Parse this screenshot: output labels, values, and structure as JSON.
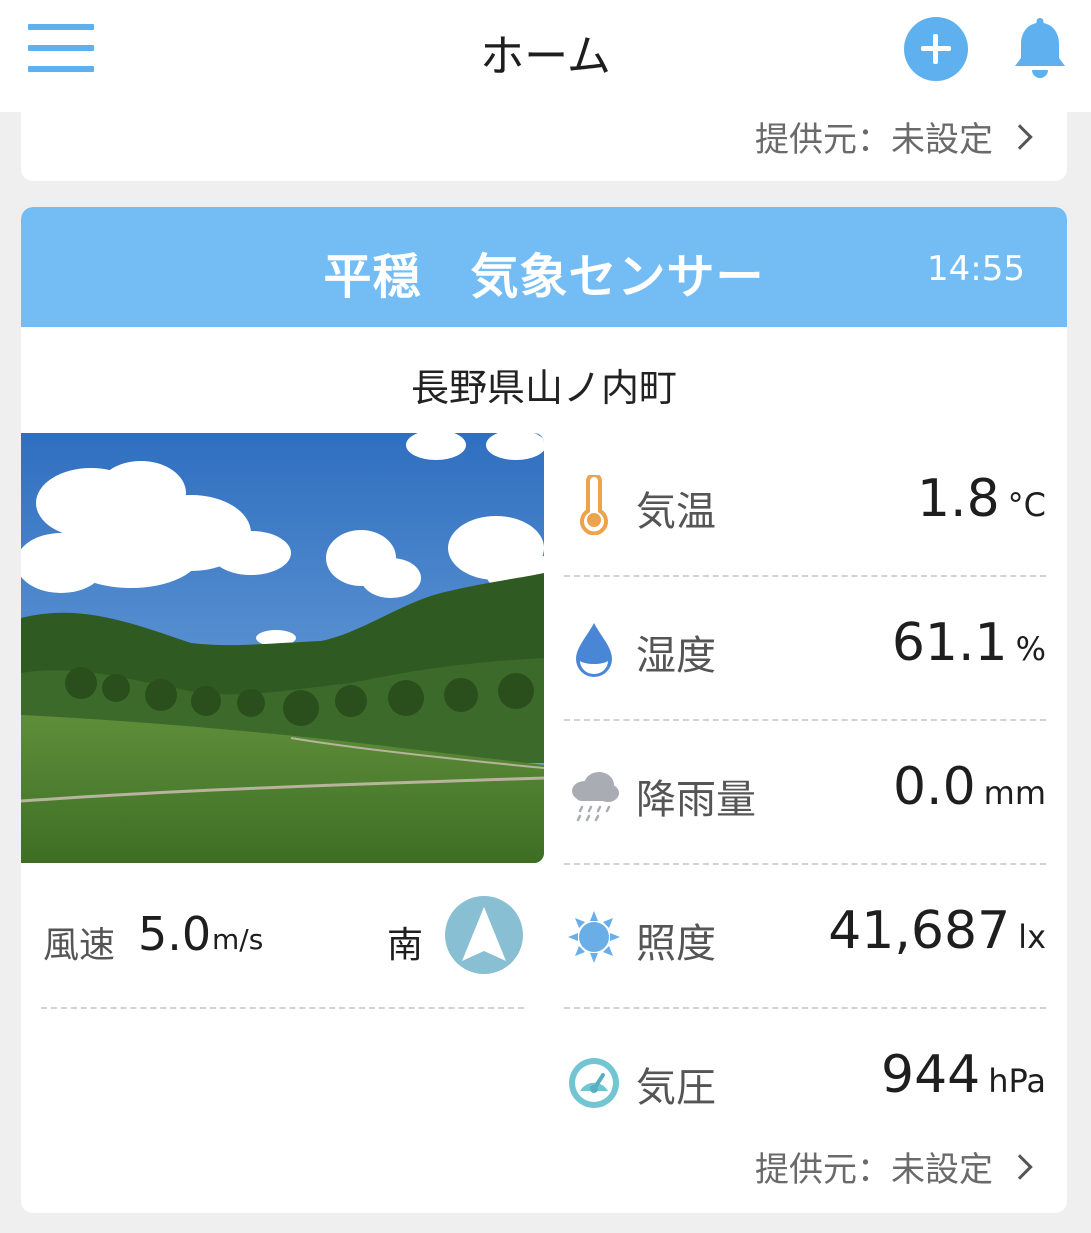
{
  "header": {
    "title": "ホーム"
  },
  "top_card": {
    "provider_label": "提供元：未設定"
  },
  "sensor_card": {
    "name": "平穏　気象センサー",
    "time": "14:55",
    "location": "長野県山ノ内町",
    "wind": {
      "label": "風速",
      "value": "5.0",
      "unit": "m/s",
      "direction": "南"
    },
    "metrics": [
      {
        "label": "気温",
        "value": "1.8",
        "unit": "°C",
        "icon": "thermometer-icon"
      },
      {
        "label": "湿度",
        "value": "61.1",
        "unit": "%",
        "icon": "water-drop-icon"
      },
      {
        "label": "降雨量",
        "value": "0.0",
        "unit": "mm",
        "icon": "rain-cloud-icon"
      },
      {
        "label": "照度",
        "value": "41,687",
        "unit": "lx",
        "icon": "sun-icon"
      },
      {
        "label": "気圧",
        "value": "944",
        "unit": "hPa",
        "icon": "gauge-icon"
      }
    ],
    "provider_label": "提供元：未設定"
  },
  "colors": {
    "accent": "#5eb0ee",
    "header_band": "#74bdf4",
    "background": "#efefef",
    "compass": "#88bfd2"
  }
}
